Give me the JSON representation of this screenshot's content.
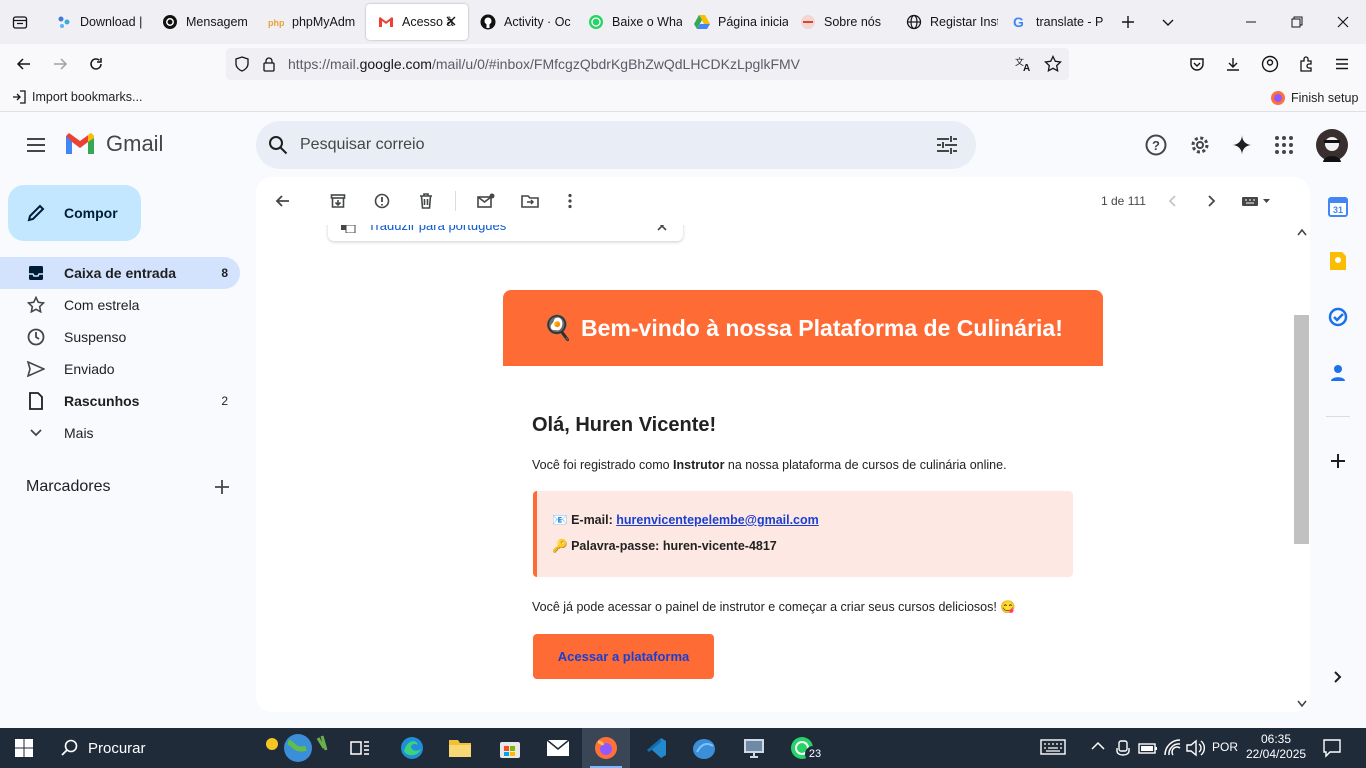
{
  "browser": {
    "tabs": [
      {
        "label": "Download |"
      },
      {
        "label": "Mensagem"
      },
      {
        "label": "phpMyAdm"
      },
      {
        "label": "Acesso à"
      },
      {
        "label": "Activity · Oc"
      },
      {
        "label": "Baixe o Wha"
      },
      {
        "label": "Página inicia"
      },
      {
        "label": "Sobre nós"
      },
      {
        "label": "Registar Inst"
      },
      {
        "label": "translate - P"
      }
    ],
    "url_prefix": "https://mail.",
    "url_domain": "google.com",
    "url_rest": "/mail/u/0/#inbox/FMfcgzQbdrKgBhZwQdLHCDKzLpglkFMV",
    "import_bookmarks": "Import bookmarks...",
    "finish_setup": "Finish setup"
  },
  "gmail": {
    "logo_text": "Gmail",
    "search_placeholder": "Pesquisar correio",
    "compose_label": "Compor",
    "nav": [
      {
        "label": "Caixa de entrada",
        "count": "8"
      },
      {
        "label": "Com estrela",
        "count": ""
      },
      {
        "label": "Suspenso",
        "count": ""
      },
      {
        "label": "Enviado",
        "count": ""
      },
      {
        "label": "Rascunhos",
        "count": "2"
      },
      {
        "label": "Mais",
        "count": ""
      }
    ],
    "labels_heading": "Marcadores",
    "pagination": "1 de 111",
    "translate_bar": "Traduzir para português"
  },
  "email": {
    "header_emoji": "🍳",
    "header_title": "Bem-vindo à nossa Plataforma de Culinária!",
    "greeting": "Olá, Huren Vicente!",
    "intro_before": "Você foi registrado como ",
    "intro_role": "Instrutor",
    "intro_after": " na nossa plataforma de cursos de culinária online.",
    "email_icon": "📧",
    "email_label": "E-mail:",
    "email_value": "hurenvicentepelembe@gmail.com",
    "password_icon": "🔑",
    "password_label": "Palavra-passe:",
    "password_value": "huren-vicente-4817",
    "closing": "Você já pode acessar o painel de instrutor e começar a criar seus cursos deliciosos! 😋",
    "cta_label": "Acessar a plataforma",
    "colors": {
      "accent": "#ff6b35",
      "box_bg": "#fde8e4",
      "box_border": "#ff6b35",
      "link": "#1a3fd0"
    }
  },
  "taskbar": {
    "search_placeholder": "Procurar",
    "whatsapp_badge": "23",
    "language": "POR",
    "time": "06:35",
    "date": "22/04/2025"
  }
}
